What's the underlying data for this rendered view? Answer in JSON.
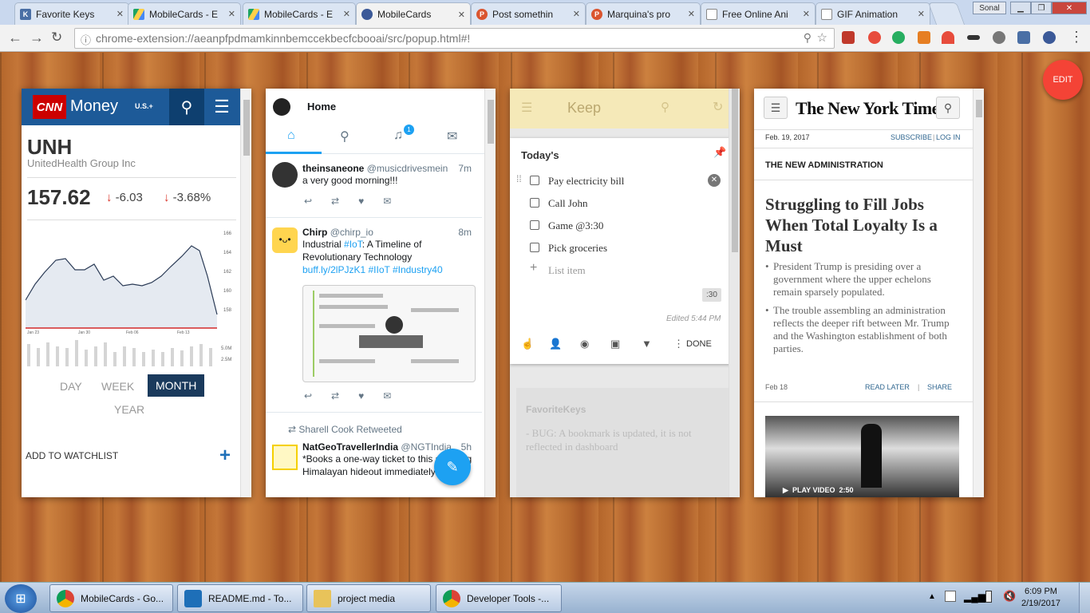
{
  "browser": {
    "tabs": [
      {
        "label": "Favorite Keys",
        "icon": "K"
      },
      {
        "label": "MobileCards - E",
        "icon": "drive"
      },
      {
        "label": "MobileCards - E",
        "icon": "drive"
      },
      {
        "label": "MobileCards",
        "icon": "extension"
      },
      {
        "label": "Post somethin",
        "icon": "P"
      },
      {
        "label": "Marquina's pro",
        "icon": "P"
      },
      {
        "label": "Free Online Ani",
        "icon": "doc"
      },
      {
        "label": "GIF Animation",
        "icon": "doc"
      }
    ],
    "profile": "Sonal",
    "url": "chrome-extension://aeanpfpdmamkinnbemccekbecfcbooai/src/popup.html#!"
  },
  "edit_button": "EDIT",
  "cnn": {
    "brand": "CNN",
    "section": "Money",
    "region": "U.S.+",
    "ticker": "UNH",
    "company": "UnitedHealth Group Inc",
    "price": "157.62",
    "change": "-6.03",
    "change_pct": "-3.68%",
    "ranges": [
      "DAY",
      "WEEK",
      "MONTH",
      "YEAR"
    ],
    "selected_range": "MONTH",
    "watchlist": "ADD TO WATCHLIST",
    "chart_axis": [
      "166",
      "164",
      "162",
      "160",
      "158"
    ],
    "chart_dates": [
      "Jan 23",
      "Jan 30",
      "Feb 06",
      "Feb 13"
    ],
    "volume_labels": [
      "5.0M",
      "2.5M"
    ]
  },
  "twitter": {
    "header": "Home",
    "badge": "1",
    "tweets": [
      {
        "name": "theinsaneone",
        "handle": "@musicdrivesmein",
        "time": "7m",
        "text": "a very good morning!!!"
      },
      {
        "name": "Chirp",
        "handle": "@chirp_io",
        "time": "8m",
        "text_a": "Industrial ",
        "tag1": "#IoT",
        "text_b": ": A Timeline of Revolutionary Technology",
        "link": "buff.ly/2lPJzK1 #IIoT #Industry40"
      },
      {
        "retweeted_by": "Sharell Cook Retweeted",
        "name": "NatGeoTravellerIndia",
        "handle": "@NGTIndia",
        "time": "5h",
        "text": "*Books a one-way ticket to this stunning Himalayan hideout immediately*"
      }
    ]
  },
  "keep": {
    "app": "Keep",
    "note_title": "Today's",
    "items": [
      "Pay electricity bill",
      "Call John",
      "Game @3:30",
      "Pick groceries"
    ],
    "add_item": "List item",
    "reminder": ":30",
    "edited": "Edited 5:44 PM",
    "done": "DONE",
    "other_title": "FavoriteKeys",
    "other_text": "- BUG: A bookmark is updated, it is not reflected in dashboard"
  },
  "nyt": {
    "logo": "The New York Times",
    "date": "Feb. 19, 2017",
    "subscribe": "SUBSCRIBE",
    "login": "LOG IN",
    "section": "THE NEW ADMINISTRATION",
    "headline": "Struggling to Fill Jobs When Total Loyalty Is a Must",
    "bullets": [
      "President Trump is presiding over a government where the upper echelons remain sparsely populated.",
      "The trouble assembling an administration reflects the deeper rift between Mr. Trump and the Washington establishment of both parties."
    ],
    "story_date": "Feb 18",
    "read_later": "READ LATER",
    "share": "SHARE",
    "play": "PLAY VIDEO",
    "duration": "2:50"
  },
  "taskbar": {
    "items": [
      "MobileCards - Go...",
      "README.md - To...",
      "project media",
      "Developer Tools -..."
    ],
    "time": "6:09 PM",
    "date": "2/19/2017"
  },
  "colors": {
    "cnn_blue": "#1d5a98",
    "twitter_blue": "#1da1f2",
    "keep_yellow": "#f5e9b8",
    "edit_red": "#f44336"
  }
}
